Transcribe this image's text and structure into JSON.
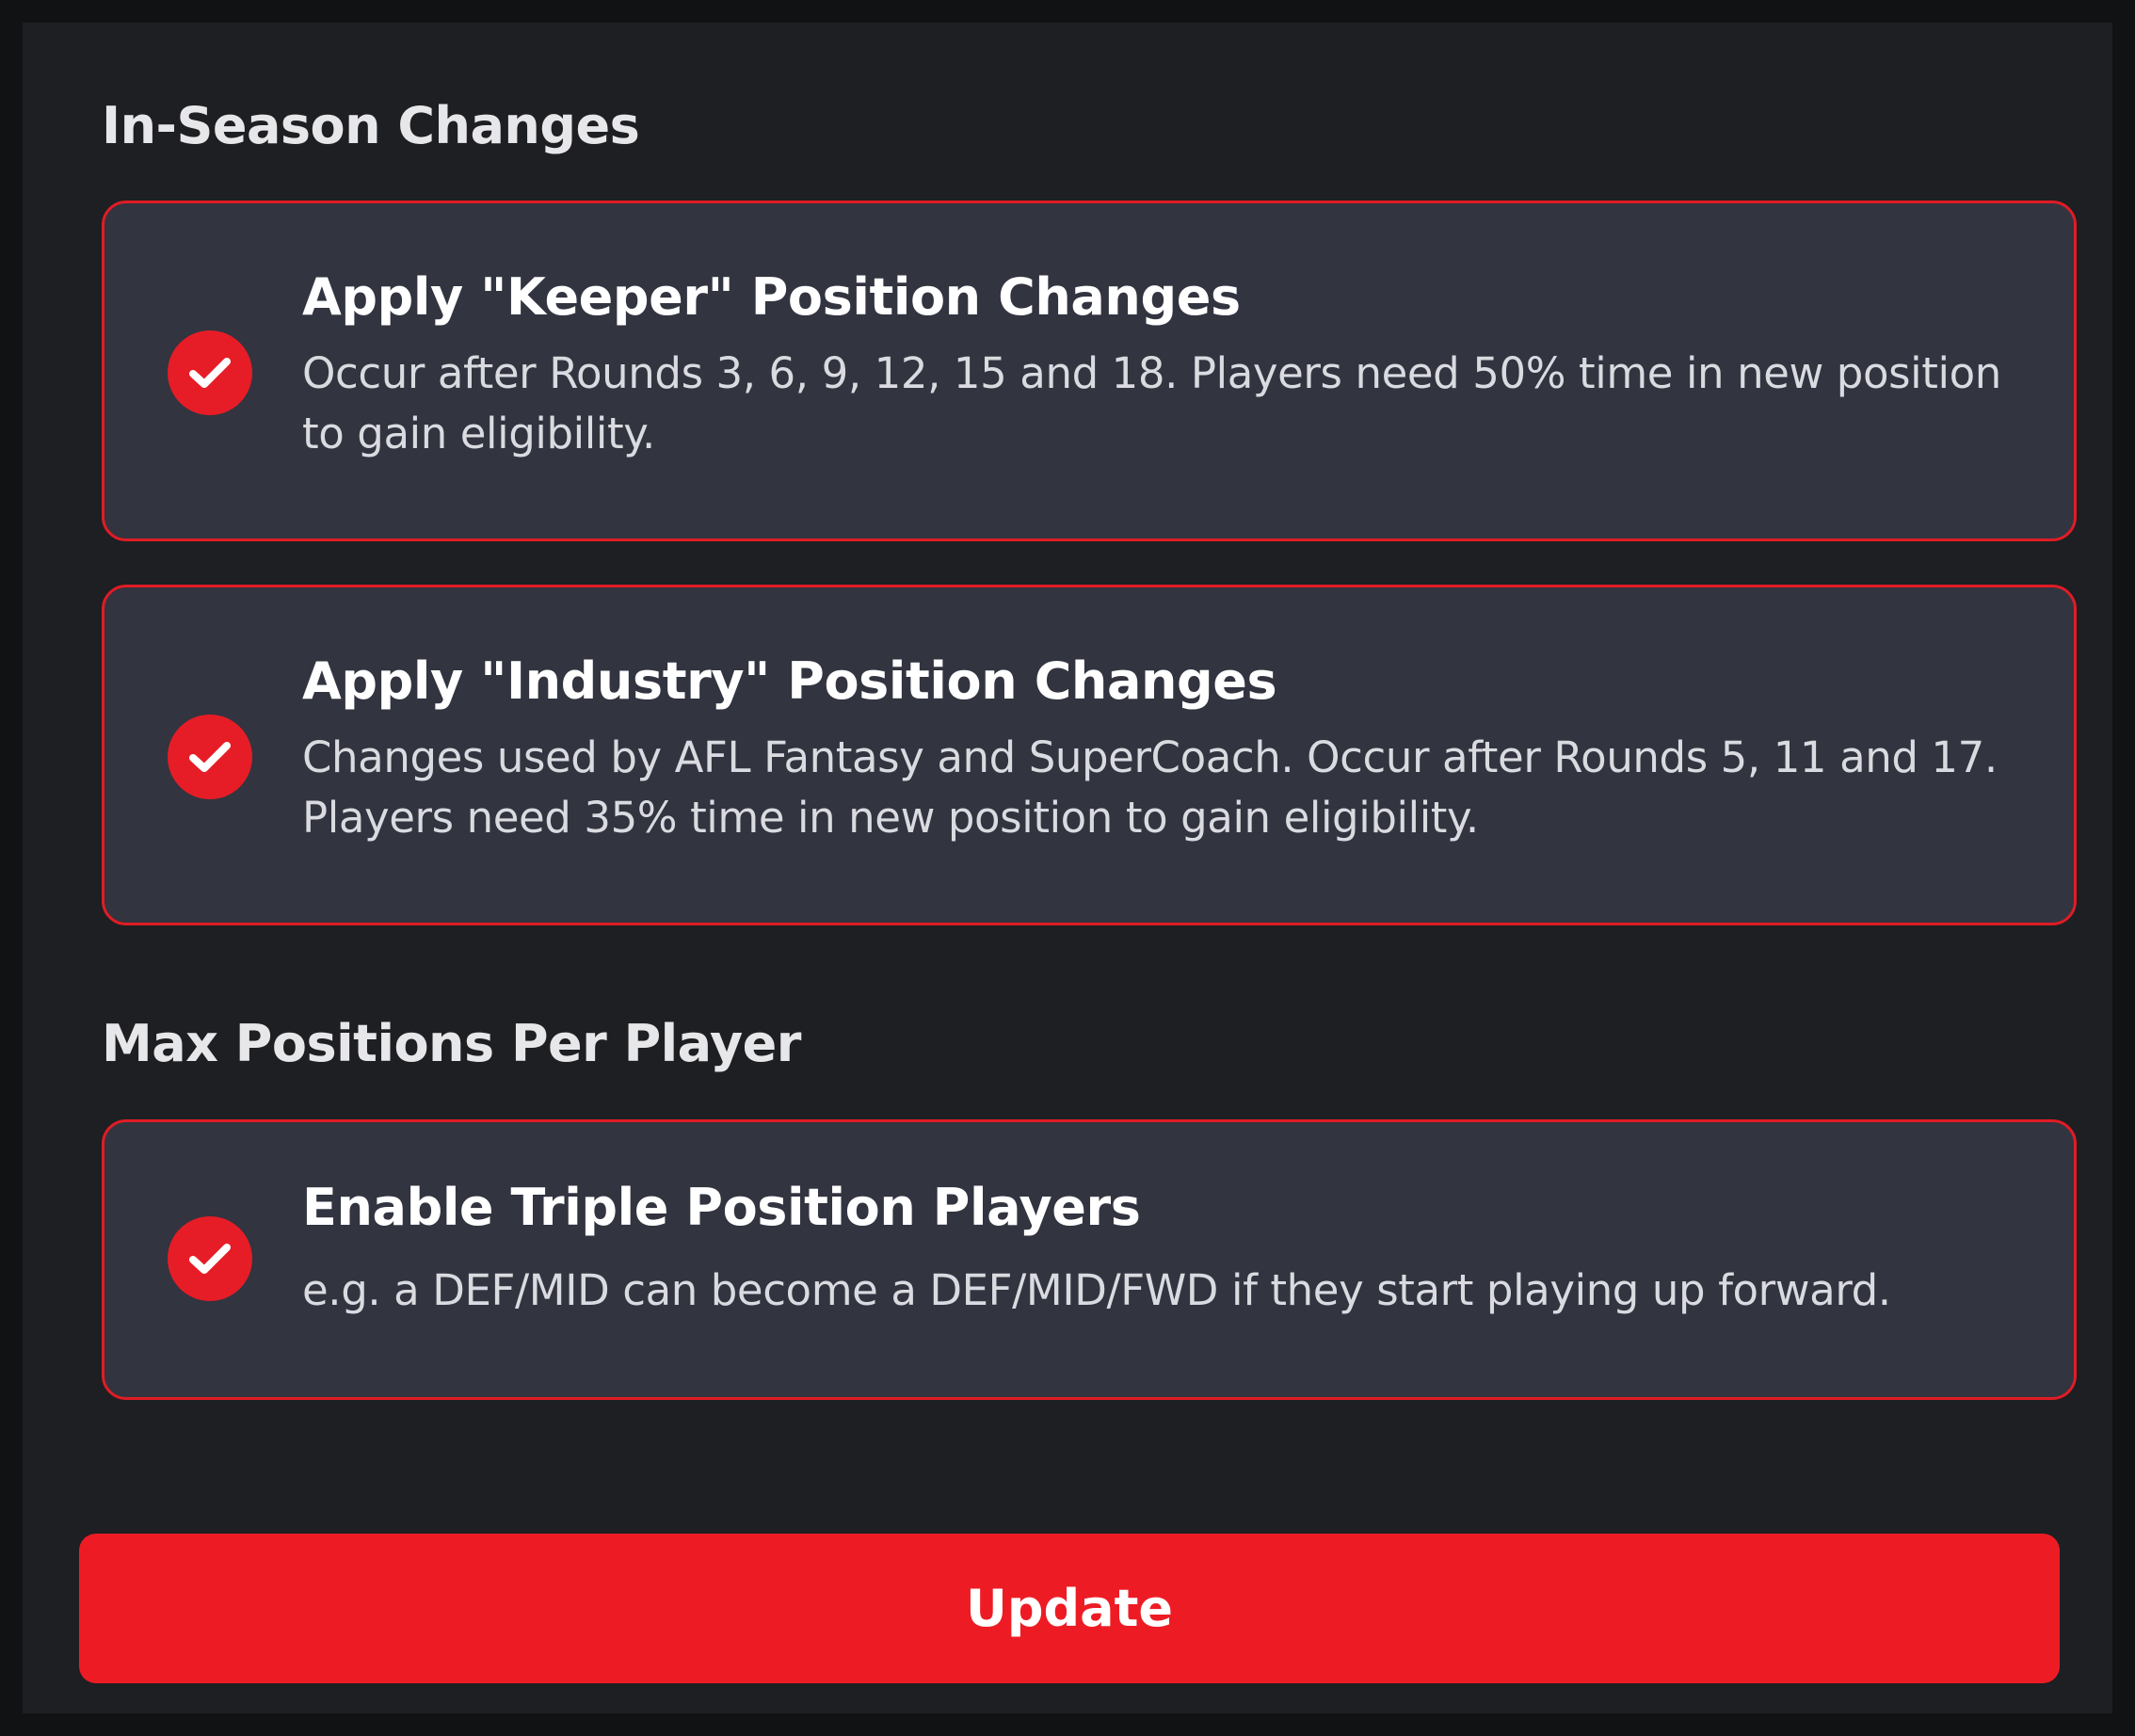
{
  "colors": {
    "accent": "#ed1c24",
    "card_background": "#323440",
    "panel_background": "#1d1f23"
  },
  "sections": {
    "in_season": {
      "title": "In-Season Changes",
      "options": [
        {
          "title": "Apply \"Keeper\" Position Changes",
          "description": "Occur after Rounds 3, 6, 9, 12, 15 and 18. Players need 50% time in new position to gain eligibility.",
          "checked": true,
          "icon": "check-circle-icon"
        },
        {
          "title": "Apply \"Industry\" Position Changes",
          "description": "Changes used by AFL Fantasy and SuperCoach. Occur after Rounds 5, 11 and 17. Players need 35% time in new position to gain eligibility.",
          "checked": true,
          "icon": "check-circle-icon"
        }
      ]
    },
    "max_positions": {
      "title": "Max Positions Per Player",
      "options": [
        {
          "title": "Enable Triple Position Players",
          "description": "e.g. a DEF/MID can become a DEF/MID/FWD if they start playing up forward.",
          "checked": true,
          "icon": "check-circle-icon"
        }
      ]
    }
  },
  "update_button": {
    "label": "Update"
  }
}
